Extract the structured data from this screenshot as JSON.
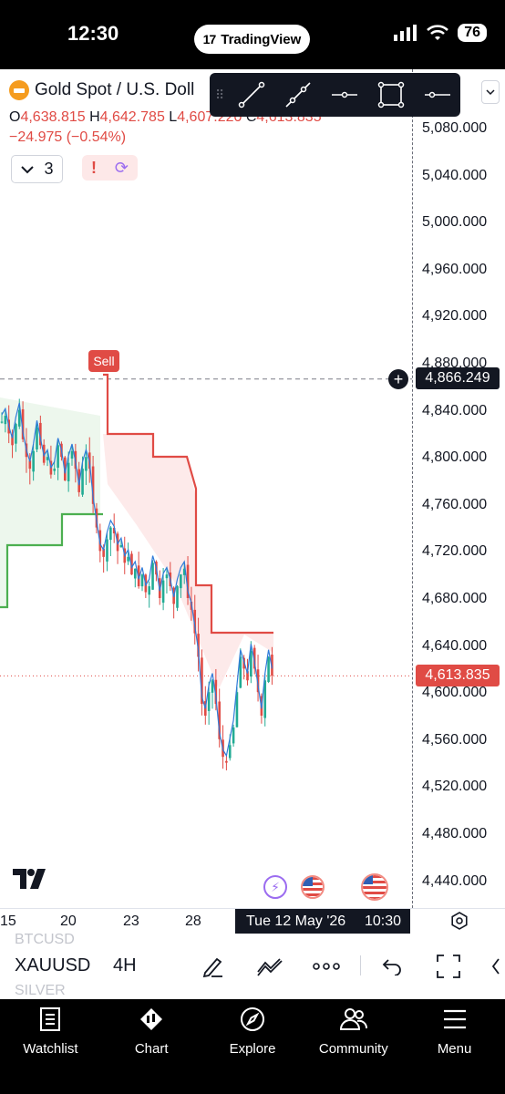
{
  "status_bar": {
    "time": "12:30",
    "app_pill": "TradingView",
    "battery": "76"
  },
  "chart": {
    "symbol_name": "Gold Spot / U.S. Doll",
    "ohlc": {
      "o_label": "O",
      "o_value": "4,638.815",
      "h_label": "H",
      "h_value": "4,642.785",
      "l_label": "L",
      "l_value": "4,607.220",
      "c_label": "C",
      "c_value": "4,613.835"
    },
    "change": "−24.975 (−0.54%)",
    "indicator_count": "3",
    "sell_badge": "Sell",
    "crosshair_price": "4,866.249",
    "last_price": "4,613.835",
    "price_axis": [
      "5,080.000",
      "5,040.000",
      "5,000.000",
      "4,960.000",
      "4,920.000",
      "4,880.000",
      "4,840.000",
      "4,800.000",
      "4,760.000",
      "4,720.000",
      "4,680.000",
      "4,640.000",
      "4,600.000",
      "4,560.000",
      "4,520.000",
      "4,480.000",
      "4,440.000"
    ],
    "time_axis": [
      "15",
      "20",
      "23",
      "28"
    ],
    "crosshair_date": "Tue 12 May '26",
    "crosshair_time": "10:30",
    "colors": {
      "down": "#e04b45",
      "up": "#22ab94",
      "ma": "#2f7bd9",
      "stop_up": "#4caf50"
    }
  },
  "drawing_toolbar": [
    "trend-line-tool",
    "ray-tool",
    "horizontal-ray-tool",
    "rectangle-tool",
    "horizontal-line-tool"
  ],
  "symbol_bar": {
    "ghost_above": "BTCUSD",
    "ghost_below": "SILVER",
    "symbol": "XAUUSD",
    "interval": "4H"
  },
  "nav": [
    {
      "label": "Watchlist",
      "icon": "bookmark-icon"
    },
    {
      "label": "Chart",
      "icon": "candles-icon"
    },
    {
      "label": "Explore",
      "icon": "compass-icon"
    },
    {
      "label": "Community",
      "icon": "people-icon"
    },
    {
      "label": "Menu",
      "icon": "hamburger-icon"
    }
  ]
}
